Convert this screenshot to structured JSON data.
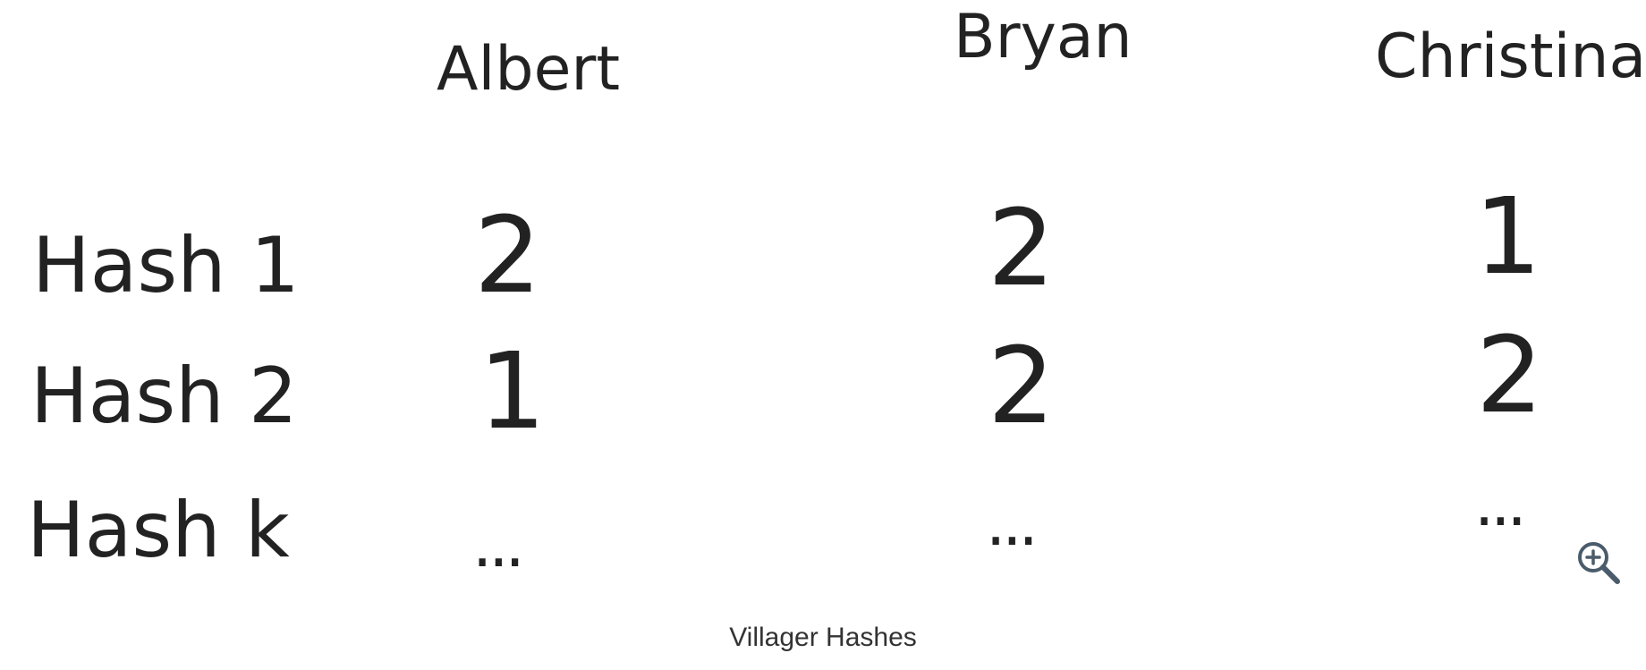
{
  "figure": {
    "columns": [
      "Albert",
      "Bryan",
      "Christina"
    ],
    "rows": [
      {
        "label": "Hash 1",
        "values": [
          "2",
          "2",
          "1"
        ]
      },
      {
        "label": "Hash 2",
        "values": [
          "1",
          "2",
          "2"
        ]
      },
      {
        "label": "Hash k",
        "values": [
          "...",
          "...",
          "..."
        ]
      }
    ]
  },
  "caption": "Villager Hashes",
  "controls": {
    "zoom_icon": "zoom-in-icon",
    "icon_color": "#4a5b6b"
  }
}
